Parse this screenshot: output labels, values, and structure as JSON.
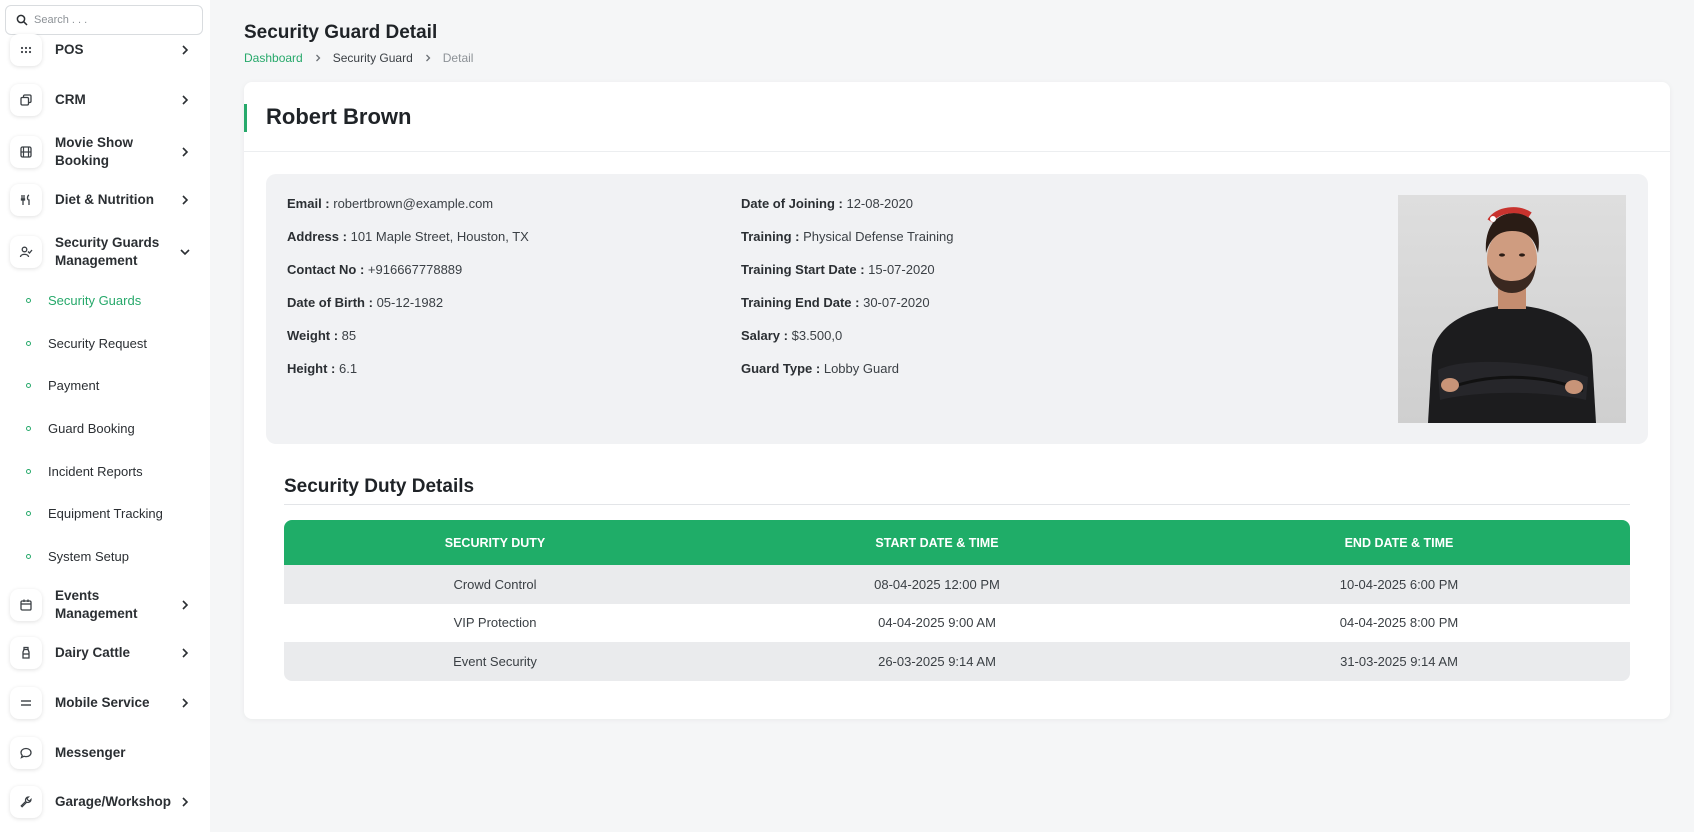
{
  "search": {
    "placeholder": "Search . . ."
  },
  "sidebar": {
    "items": [
      {
        "label": "POS",
        "icon": "grid-dots-icon"
      },
      {
        "label": "CRM",
        "icon": "copy-icon"
      },
      {
        "label": "Movie Show Booking",
        "icon": "film-icon"
      },
      {
        "label": "Diet & Nutrition",
        "icon": "utensils-icon"
      },
      {
        "label": "Security Guards Management",
        "icon": "user-check-icon"
      },
      {
        "label": "Events Management",
        "icon": "calendar-icon"
      },
      {
        "label": "Dairy Cattle",
        "icon": "milk-bottle-icon"
      },
      {
        "label": "Mobile Service",
        "icon": "equals-icon"
      },
      {
        "label": "Messenger",
        "icon": "chat-bubble-icon"
      },
      {
        "label": "Garage/Workshop",
        "icon": "wrench-icon"
      }
    ],
    "sub_items": [
      {
        "label": "Security Guards",
        "active": true
      },
      {
        "label": "Security Request"
      },
      {
        "label": "Payment"
      },
      {
        "label": "Guard Booking"
      },
      {
        "label": "Incident Reports"
      },
      {
        "label": "Equipment Tracking"
      },
      {
        "label": "System Setup"
      }
    ]
  },
  "header": {
    "title": "Security Guard Detail",
    "breadcrumb": [
      "Dashboard",
      "Security Guard",
      "Detail"
    ]
  },
  "guard": {
    "name": "Robert Brown",
    "left": [
      {
        "k": "Email :",
        "v": "robertbrown@example.com"
      },
      {
        "k": "Address :",
        "v": "101 Maple Street, Houston, TX"
      },
      {
        "k": "Contact No :",
        "v": "+916667778889"
      },
      {
        "k": "Date of Birth :",
        "v": "05-12-1982"
      },
      {
        "k": "Weight :",
        "v": "85"
      },
      {
        "k": "Height :",
        "v": "6.1"
      }
    ],
    "right": [
      {
        "k": "Date of Joining :",
        "v": "12-08-2020"
      },
      {
        "k": "Training :",
        "v": "Physical Defense Training"
      },
      {
        "k": "Training Start Date :",
        "v": "15-07-2020"
      },
      {
        "k": "Training End Date :",
        "v": "30-07-2020"
      },
      {
        "k": "Salary :",
        "v": "$3.500,0"
      },
      {
        "k": "Guard Type :",
        "v": "Lobby Guard"
      }
    ]
  },
  "duty": {
    "title": "Security Duty Details",
    "columns": [
      "SECURITY DUTY",
      "START DATE & TIME",
      "END DATE & TIME"
    ],
    "rows": [
      [
        "Crowd Control",
        "08-04-2025 12:00 PM",
        "10-04-2025 6:00 PM"
      ],
      [
        "VIP Protection",
        "04-04-2025 9:00 AM",
        "04-04-2025 8:00 PM"
      ],
      [
        "Event Security",
        "26-03-2025 9:14 AM",
        "31-03-2025 9:14 AM"
      ]
    ]
  },
  "colors": {
    "accent": "#27a96b",
    "table_header": "#1fad68"
  }
}
